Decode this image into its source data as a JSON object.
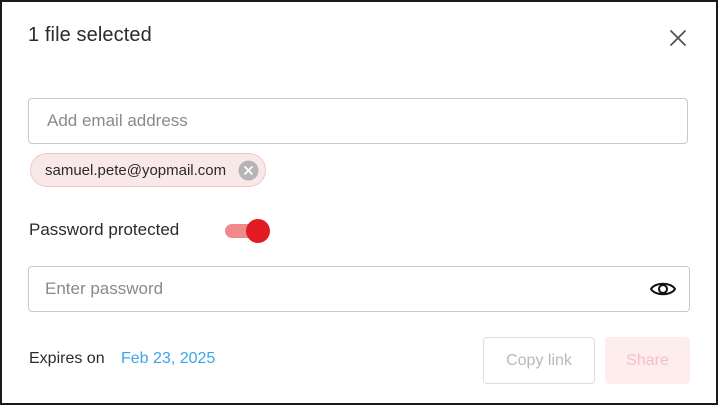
{
  "dialog": {
    "title": "1 file selected"
  },
  "email": {
    "placeholder": "Add email address",
    "value": ""
  },
  "recipients": [
    {
      "email": "samuel.pete@yopmail.com"
    }
  ],
  "password": {
    "label": "Password protected",
    "toggle_on": true,
    "placeholder": "Enter password",
    "value": ""
  },
  "expiry": {
    "label": "Expires on",
    "date": "Feb 23, 2025"
  },
  "actions": {
    "copy_label": "Copy link",
    "share_label": "Share",
    "copy_enabled": false,
    "share_enabled": false
  },
  "colors": {
    "accent": "#e31b23",
    "toggle_track": "#f08a8a",
    "link": "#3aa6e8",
    "chip_bg": "#f9e8e8"
  },
  "icons": {
    "close": "close-icon",
    "chip_remove": "remove-circle-icon",
    "password_visibility": "eye-icon"
  }
}
